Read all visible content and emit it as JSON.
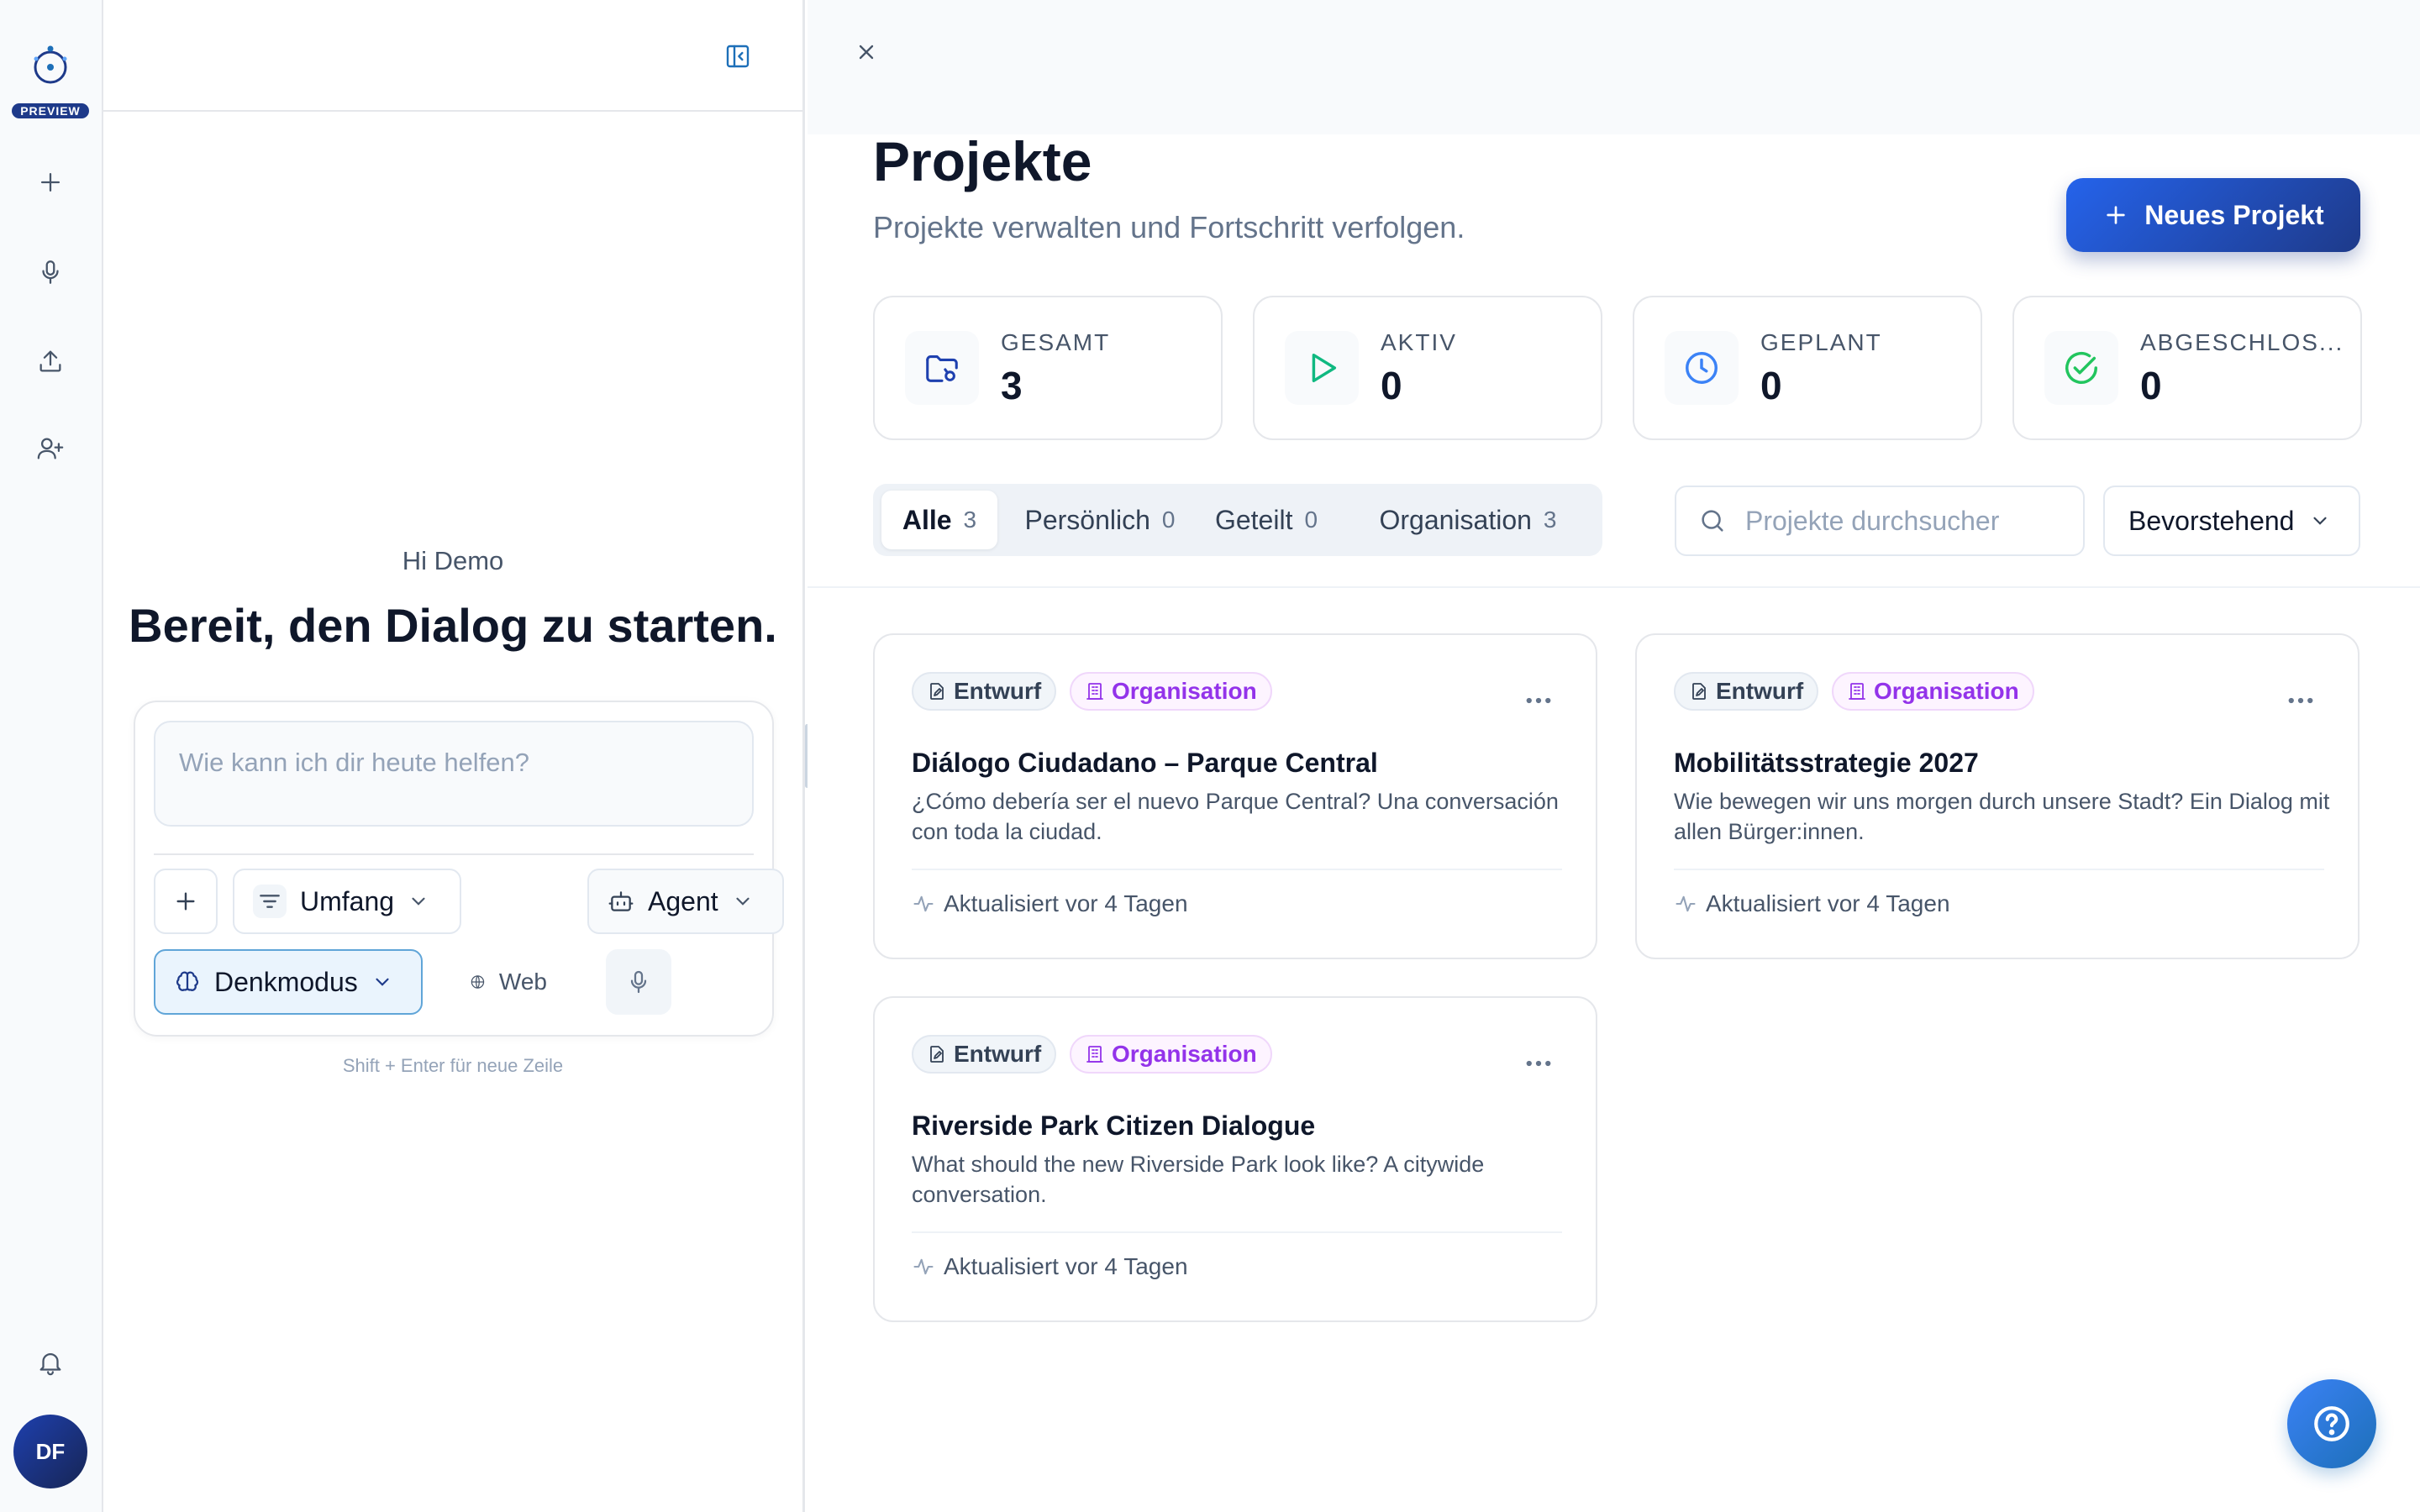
{
  "rail": {
    "badge": "PREVIEW",
    "avatar_initials": "DF",
    "icons": [
      "logo-icon",
      "plus-icon",
      "microphone-icon",
      "upload-icon",
      "user-plus-icon",
      "bell-icon"
    ]
  },
  "chat": {
    "greeting": "Hi Demo",
    "headline": "Bereit, den Dialog zu starten.",
    "input_placeholder": "Wie kann ich dir heute helfen?",
    "umfang_label": "Umfang",
    "agent_label": "Agent",
    "denkmodus_label": "Denkmodus",
    "web_label": "Web",
    "hint": "Shift + Enter für neue Zeile"
  },
  "page": {
    "title": "Projekte",
    "subtitle": "Projekte verwalten und Fortschritt verfolgen.",
    "new_button": "Neues Projekt"
  },
  "stats": [
    {
      "label": "GESAMT",
      "value": "3",
      "icon": "folder-icon",
      "color": "#1e40af"
    },
    {
      "label": "AKTIV",
      "value": "0",
      "icon": "play-icon",
      "color": "#10b981"
    },
    {
      "label": "GEPLANT",
      "value": "0",
      "icon": "clock-icon",
      "color": "#3b82f6"
    },
    {
      "label": "ABGESCHLOS...",
      "value": "0",
      "icon": "check-circle-icon",
      "color": "#22c55e"
    }
  ],
  "tabs": [
    {
      "label": "Alle",
      "count": "3",
      "active": true
    },
    {
      "label": "Persönlich",
      "count": "0"
    },
    {
      "label": "Geteilt",
      "count": "0"
    },
    {
      "label": "Organisation",
      "count": "3"
    }
  ],
  "search": {
    "placeholder": "Projekte durchsucher"
  },
  "sort": {
    "label": "Bevorstehend"
  },
  "projects": [
    {
      "status": "Entwurf",
      "scope": "Organisation",
      "title": "Diálogo Ciudadano – Parque Central",
      "description": "¿Cómo debería ser el nuevo Parque Central? Una conversación con toda la ciudad.",
      "updated": "Aktualisiert vor 4 Tagen"
    },
    {
      "status": "Entwurf",
      "scope": "Organisation",
      "title": "Mobilitätsstrategie 2027",
      "description": "Wie bewegen wir uns morgen durch unsere Stadt? Ein Dialog mit allen Bürger:innen.",
      "updated": "Aktualisiert vor 4 Tagen"
    },
    {
      "status": "Entwurf",
      "scope": "Organisation",
      "title": "Riverside Park Citizen Dialogue",
      "description": "What should the new Riverside Park look like? A citywide conversation.",
      "updated": "Aktualisiert vor 4 Tagen"
    }
  ],
  "colors": {
    "brand": "#1e3a8a",
    "accent": "#1d6fb8",
    "org_chip": "#9333ea"
  }
}
